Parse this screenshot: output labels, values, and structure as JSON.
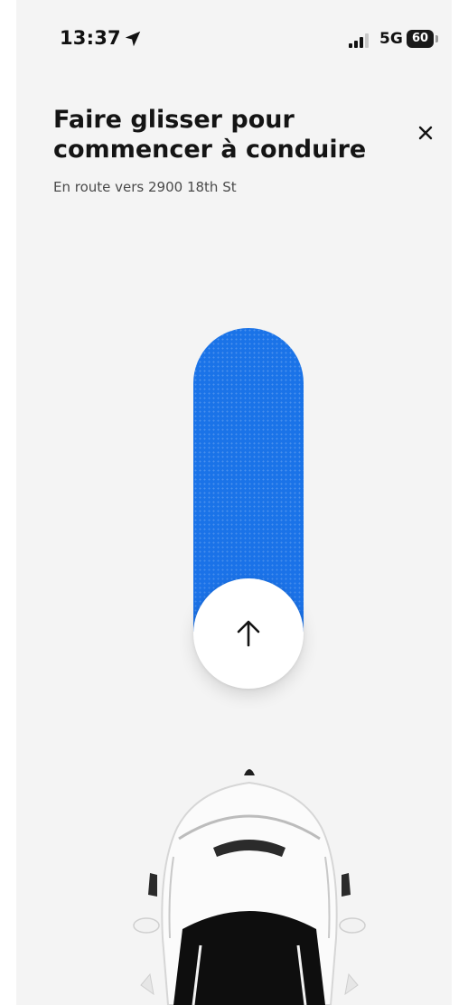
{
  "status_bar": {
    "time": "13:37",
    "network": "5G",
    "battery": "60",
    "icons": [
      "location-arrow-icon",
      "signal-icon",
      "battery-icon"
    ]
  },
  "header": {
    "title": "Faire glisser pour commencer à conduire",
    "subtitle": "En route vers 2900 18th St",
    "close_icon": "close-icon"
  },
  "slider": {
    "handle_icon": "arrow-up-icon",
    "track_color": "#1a73e8",
    "handle_color": "#ffffff"
  },
  "car": {
    "icon": "car-top-view"
  },
  "colors": {
    "background": "#f4f4f4",
    "text": "#141414",
    "accent": "#1a73e8"
  }
}
